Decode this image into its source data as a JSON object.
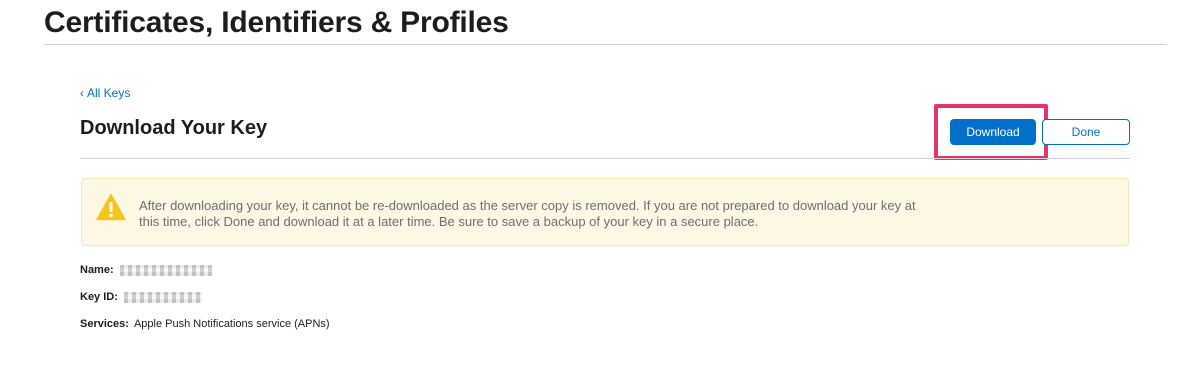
{
  "header": {
    "title": "Certificates, Identifiers & Profiles"
  },
  "breadcrumb": {
    "chevron": "‹",
    "label": "All Keys"
  },
  "section": {
    "title": "Download Your Key"
  },
  "actions": {
    "download_label": "Download",
    "done_label": "Done"
  },
  "alert": {
    "icon": "warning-icon",
    "message": "After downloading your key, it cannot be re-downloaded as the server copy is removed. If you are not prepared to download your key at this time, click Done and download it at a later time. Be sure to save a backup of your key in a secure place."
  },
  "details": {
    "name_label": "Name:",
    "key_id_label": "Key ID:",
    "services_label": "Services:",
    "services_value": "Apple Push Notifications service (APNs)"
  },
  "colors": {
    "accent": "#0070c9",
    "highlight": "#e8326d",
    "alert_background": "#fdf8e3",
    "warning_icon": "#f5c518"
  }
}
